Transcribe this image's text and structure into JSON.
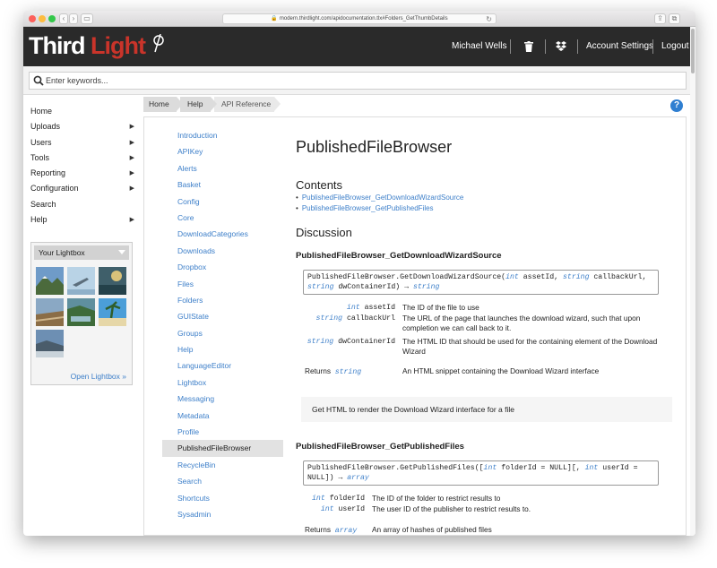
{
  "browser": {
    "url": "modern.thirdlight.com/apidocumentation.tlx#Folders_GetThumbDetails"
  },
  "header": {
    "logo_a": "Third",
    "logo_b": "Light",
    "user": "Michael Wells",
    "account_settings": "Account Settings",
    "logout": "Logout"
  },
  "search": {
    "placeholder": "Enter keywords..."
  },
  "menu": {
    "items": [
      {
        "label": "Home",
        "arrow": ""
      },
      {
        "label": "Uploads",
        "arrow": "▶"
      },
      {
        "label": "Users",
        "arrow": "▶"
      },
      {
        "label": "Tools",
        "arrow": "▶"
      },
      {
        "label": "Reporting",
        "arrow": "▶"
      },
      {
        "label": "Configuration",
        "arrow": "▶"
      },
      {
        "label": "Search",
        "arrow": ""
      },
      {
        "label": "Help",
        "arrow": "▶"
      }
    ]
  },
  "lightbox": {
    "title": "Your Lightbox",
    "open_link": "Open Lightbox »"
  },
  "breadcrumb": [
    "Home",
    "Help",
    "API Reference"
  ],
  "help_glyph": "?",
  "apinav": {
    "items": [
      "Introduction",
      "APIKey",
      "Alerts",
      "Basket",
      "Config",
      "Core",
      "DownloadCategories",
      "Downloads",
      "Dropbox",
      "Files",
      "Folders",
      "GUIState",
      "Groups",
      "Help",
      "LanguageEditor",
      "Lightbox",
      "Messaging",
      "Metadata",
      "Profile",
      "PublishedFileBrowser",
      "RecycleBin",
      "Search",
      "Shortcuts",
      "Sysadmin"
    ],
    "active": "PublishedFileBrowser"
  },
  "doc": {
    "title": "PublishedFileBrowser",
    "contents_heading": "Contents",
    "contents_links": [
      "PublishedFileBrowser_GetDownloadWizardSource",
      "PublishedFileBrowser_GetPublishedFiles"
    ],
    "discussion_heading": "Discussion",
    "m1": {
      "name": "PublishedFileBrowser_GetDownloadWizardSource",
      "sig_prefix": "PublishedFileBrowser.GetDownloadWizardSource(",
      "sig_t1": "int",
      "sig_a1": " assetId, ",
      "sig_t2": "string",
      "sig_a2": " callbackUrl,",
      "sig_t3": "string",
      "sig_a3": " dwContainerId) → ",
      "sig_ret": "string",
      "params": [
        {
          "type": "int",
          "name": "assetId",
          "desc": "The ID of the file to use"
        },
        {
          "type": "string",
          "name": "callbackUrl",
          "desc": "The URL of the page that launches the download wizard, such that upon completion we can call back to it."
        },
        {
          "type": "string",
          "name": "dwContainerId",
          "desc": "The HTML ID that should be used for the containing element of the Download Wizard"
        }
      ],
      "returns_label": "Returns",
      "returns_type": "string",
      "returns_desc": "An HTML snippet containing the Download Wizard interface",
      "summary": "Get HTML to render the Download Wizard interface for a file"
    },
    "m2": {
      "name": "PublishedFileBrowser_GetPublishedFiles",
      "sig_prefix": "PublishedFileBrowser.GetPublishedFiles([",
      "sig_t1": "int",
      "sig_a1": " folderId = NULL][, ",
      "sig_t2": "int",
      "sig_a2": " userId =",
      "sig_a3": "NULL]) → ",
      "sig_ret": "array",
      "params": [
        {
          "type": "int",
          "name": "folderId",
          "desc": "The ID of the folder to restrict results to"
        },
        {
          "type": "int",
          "name": "userId",
          "desc": "The user ID of the publisher to restrict results to."
        }
      ],
      "returns_label": "Returns",
      "returns_type": "array",
      "returns_desc": "An array of hashes of published files"
    }
  }
}
